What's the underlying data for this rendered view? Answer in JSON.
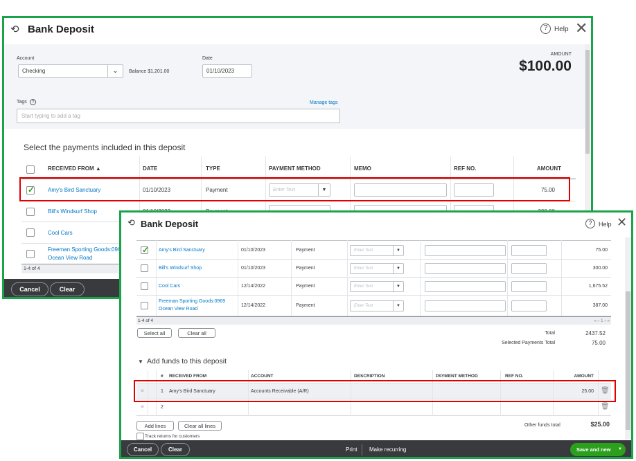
{
  "back": {
    "title": "Bank Deposit",
    "help": "Help",
    "account_label": "Account",
    "account_value": "Checking",
    "balance": "Balance $1,201.00",
    "date_label": "Date",
    "date_value": "01/10/2023",
    "amount_label": "AMOUNT",
    "amount_value": "$100.00",
    "tags_label": "Tags",
    "manage_tags": "Manage tags",
    "tags_placeholder": "Start typing to add a tag",
    "section_title": "Select the payments included in this deposit",
    "columns": [
      "RECEIVED FROM ▲",
      "DATE",
      "TYPE",
      "PAYMENT METHOD",
      "MEMO",
      "REF NO.",
      "AMOUNT"
    ],
    "rows": [
      {
        "from": "Amy's Bird Sanctuary",
        "date": "01/10/2023",
        "type": "Payment",
        "method": "Enter Text",
        "amount": "75.00",
        "checked": true
      },
      {
        "from": "Bill's Windsurf Shop",
        "date": "01/10/2023",
        "type": "Payment",
        "method": "Enter Text",
        "amount": "300.00",
        "checked": false
      },
      {
        "from": "Cool Cars",
        "checked": false
      },
      {
        "from": "Freeman Sporting Goods:0969",
        "from2": "Ocean View Road",
        "checked": false
      }
    ],
    "pager": "1-4 of 4",
    "cancel": "Cancel",
    "clear": "Clear"
  },
  "front": {
    "title": "Bank Deposit",
    "help": "Help",
    "rows": [
      {
        "from": "Amy's Bird Sanctuary",
        "date": "01/10/2023",
        "type": "Payment",
        "method": "Enter Text",
        "amount": "75.00",
        "checked": true
      },
      {
        "from": "Bill's Windsurf Shop",
        "date": "01/10/2023",
        "type": "Payment",
        "method": "Enter Text",
        "amount": "300.00",
        "checked": false
      },
      {
        "from": "Cool Cars",
        "date": "12/14/2022",
        "type": "Payment",
        "method": "Enter Text",
        "amount": "1,675.52",
        "checked": false
      },
      {
        "from": "Freeman Sporting Goods:0969",
        "from2": "Ocean View Road",
        "date": "12/14/2022",
        "type": "Payment",
        "method": "Enter Text",
        "amount": "387.00",
        "checked": false
      }
    ],
    "pager": "1-4 of 4",
    "pager_nav": "« ‹ 1 › »",
    "select_all": "Select all",
    "clear_all": "Clear all",
    "total_label": "Total",
    "total_value": "2437.52",
    "selected_label": "Selected Payments Total",
    "selected_value": "75.00",
    "funds_title": "Add funds to this deposit",
    "funds_columns": [
      "#",
      "RECEIVED FROM",
      "ACCOUNT",
      "DESCRIPTION",
      "PAYMENT METHOD",
      "REF NO.",
      "AMOUNT"
    ],
    "funds_rows": [
      {
        "num": "1",
        "from": "Amy's Bird Sanctuary",
        "account": "Accounts Receivable (A/R)",
        "amount": "25.00"
      },
      {
        "num": "2"
      }
    ],
    "add_lines": "Add lines",
    "clear_all_lines": "Clear all lines",
    "other_total_label": "Other funds total",
    "other_total_value": "$25.00",
    "track_returns": "Track returns for customers",
    "cancel": "Cancel",
    "clear": "Clear",
    "print": "Print",
    "make_recurring": "Make recurring",
    "save_new": "Save and new"
  },
  "colors": {
    "frame": "#1aa34a",
    "highlight": "#e00000",
    "link": "#0077c5",
    "save": "#2ca01c",
    "footer": "#393a3d"
  }
}
